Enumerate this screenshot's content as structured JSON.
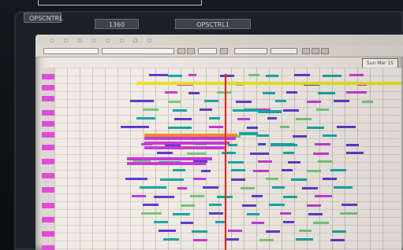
{
  "monitor": {
    "left_label": "OPSCNTRL",
    "mid_label": "1360",
    "right_label": "OPSCTRL1"
  },
  "screen": {
    "date_label": "Sun Mar 15"
  }
}
